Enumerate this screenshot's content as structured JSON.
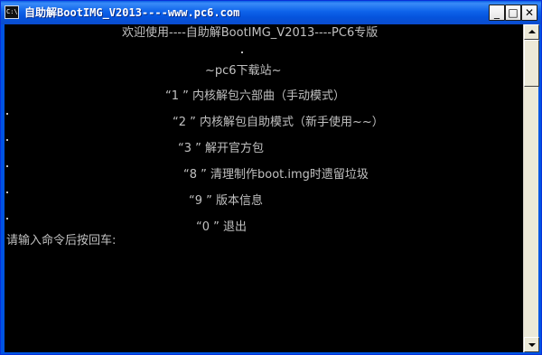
{
  "window": {
    "title": "自助解BootIMG_V2013----www.pc6.com",
    "icon_text": "C:\\",
    "icon_name": "console-icon"
  },
  "title_buttons": {
    "minimize": "_",
    "maximize": "□",
    "close": "✕"
  },
  "console": {
    "header": "欢迎使用----自助解BootIMG_V2013----PC6专版",
    "site": "~pc6下载站~",
    "menu": [
      {
        "text": "“1 ” 内核解包六部曲（手动模式）"
      },
      {
        "text": "“2 ” 内核解包自助模式（新手使用~~）"
      },
      {
        "text": "“3 ” 解开官方包"
      },
      {
        "text": "“8 ” 清理制作boot.img时遗留垃圾"
      },
      {
        "text": "“9 ” 版本信息"
      },
      {
        "text": "“0 ” 退出"
      }
    ],
    "prompt": "请输入命令后按回车:"
  },
  "colors": {
    "title_bar": "#0054e3",
    "console_bg": "#000000",
    "console_text": "#c0c0c0"
  }
}
